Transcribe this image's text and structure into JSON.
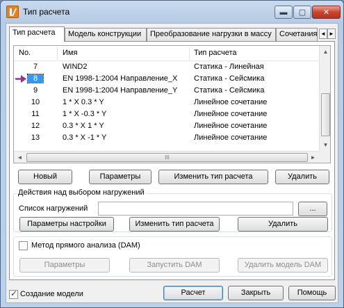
{
  "window": {
    "title": "Тип расчета"
  },
  "window_controls": {
    "minimize": "▬",
    "maximize": "▢",
    "close": "✕"
  },
  "tabs": [
    {
      "label": "Тип расчета",
      "active": true
    },
    {
      "label": "Модель конструкции",
      "active": false
    },
    {
      "label": "Преобразование нагрузки в массу",
      "active": false
    },
    {
      "label": "Сочетания",
      "active": false
    }
  ],
  "tab_scroll": {
    "left": "◄",
    "right": "►"
  },
  "list": {
    "headers": {
      "num": "No.",
      "name": "Имя",
      "type": "Тип расчета"
    },
    "rows": [
      {
        "num": "7",
        "name": "WIND2",
        "type": "Статика - Линейная",
        "selected": false
      },
      {
        "num": "8",
        "name": "EN 1998-1:2004 Направление_X",
        "type": "Статика - Сейсмика",
        "selected": true
      },
      {
        "num": "9",
        "name": "EN 1998-1:2004 Направление_Y",
        "type": "Статика - Сейсмика",
        "selected": false
      },
      {
        "num": "10",
        "name": "1 * X  0.3 * Y",
        "type": "Линейное сочетание",
        "selected": false
      },
      {
        "num": "11",
        "name": "1 * X  -0.3 * Y",
        "type": "Линейное сочетание",
        "selected": false
      },
      {
        "num": "12",
        "name": "0.3 * X  1 * Y",
        "type": "Линейное сочетание",
        "selected": false
      },
      {
        "num": "13",
        "name": "0.3 * X  -1 * Y",
        "type": "Линейное сочетание",
        "selected": false
      }
    ],
    "scroll_glyphs": {
      "up": "▲",
      "down": "▼",
      "left": "◄",
      "right": "►",
      "grip": "III"
    }
  },
  "list_buttons": {
    "new": "Новый",
    "params": "Параметры",
    "change_type": "Изменить тип расчета",
    "delete": "Удалить"
  },
  "selection_group": {
    "title": "Действия над выбором нагружений",
    "loads_label": "Список нагружений",
    "loads_value": "",
    "browse": "...",
    "settings_button": "Параметры настройки",
    "change_type_button": "Изменить тип расчета",
    "delete_button": "Удалить"
  },
  "dam_group": {
    "checkbox_label": "Метод прямого анализа (DAM)",
    "checked": false,
    "params_button": "Параметры",
    "run_button": "Запустить DAM",
    "delete_model_button": "Удалить модель DAM"
  },
  "footer": {
    "create_model_label": "Создание модели",
    "create_model_checked": true,
    "calc_button": "Расчет",
    "close_button": "Закрыть",
    "help_button": "Помощь"
  }
}
